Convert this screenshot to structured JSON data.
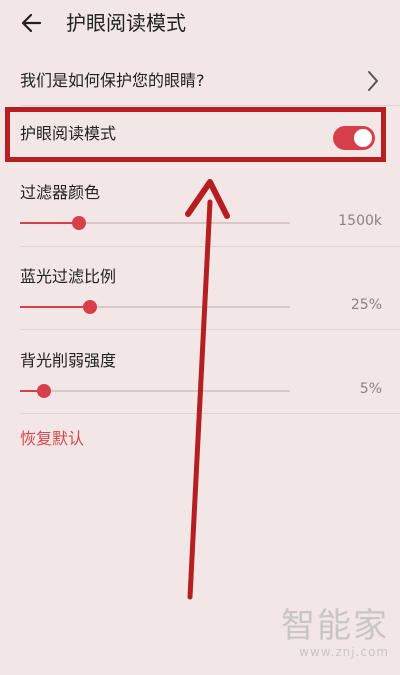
{
  "header": {
    "title": "护眼阅读模式",
    "back_icon": "arrow-left-icon"
  },
  "info_link": {
    "label": "我们是如何保护您的眼睛?",
    "icon": "chevron-right-icon"
  },
  "eye_mode": {
    "label": "护眼阅读模式",
    "enabled": true
  },
  "settings": [
    {
      "label": "过滤器颜色",
      "value": "1500k",
      "level": 0.22
    },
    {
      "label": "蓝光过滤比例",
      "value": "25%",
      "level": 0.26
    },
    {
      "label": "背光削弱强度",
      "value": "5%",
      "level": 0.09
    }
  ],
  "reset_label": "恢复默认",
  "watermark": {
    "brand": "智能家",
    "url": "www.znj.com"
  },
  "colors": {
    "background": "#f3e6e6",
    "accent": "#d7404a",
    "highlight": "#b51f22",
    "reset_text": "#d44b4d"
  }
}
